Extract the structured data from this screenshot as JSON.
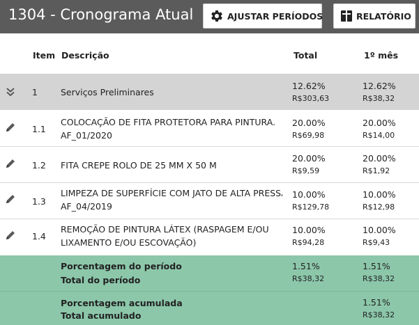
{
  "header": {
    "title": "1304 - Cronograma Atual",
    "ajustar_label": "AJUSTAR PERÍODOS",
    "relatorio_label": "RELATÓRIO"
  },
  "table": {
    "columns": {
      "item": "Item",
      "descricao": "Descrição",
      "total": "Total",
      "mes1": "1º mês"
    },
    "group": {
      "item": "1",
      "descricao": "Serviços Preliminares",
      "total_pct": "12.62%",
      "total_val": "R$303,63",
      "mes_pct": "12.62%",
      "mes_val": "R$38,32",
      "icon": "double-chevron-down-icon"
    },
    "rows": [
      {
        "item": "1.1",
        "desc_line1": "COLOCAÇÃO DE FITA PROTETORA PARA PINTURA.",
        "desc_line2": "AF_01/2020",
        "total_pct": "20.00%",
        "total_val": "R$69,98",
        "mes_pct": "20.00%",
        "mes_val": "R$14,00",
        "icon": "pencil-icon"
      },
      {
        "item": "1.2",
        "desc_line1": "FITA CREPE ROLO DE 25 MM X 50 M",
        "desc_line2": "",
        "total_pct": "20.00%",
        "total_val": "R$9,59",
        "mes_pct": "20.00%",
        "mes_val": "R$1,92",
        "icon": "pencil-icon"
      },
      {
        "item": "1.3",
        "desc_line1": "LIMPEZA DE SUPERFÍCIE COM JATO DE ALTA PRESSÃO.",
        "desc_line2": "AF_04/2019",
        "total_pct": "10.00%",
        "total_val": "R$129,78",
        "mes_pct": "10.00%",
        "mes_val": "R$12,98",
        "icon": "pencil-icon"
      },
      {
        "item": "1.4",
        "desc_line1": "REMOÇÃO DE PINTURA LÁTEX (RASPAGEM E/OU",
        "desc_line2": "LIXAMENTO E/OU ESCOVAÇÃO)",
        "total_pct": "10.00%",
        "total_val": "R$94,28",
        "mes_pct": "10.00%",
        "mes_val": "R$9,43",
        "icon": "pencil-icon"
      }
    ]
  },
  "summary": {
    "periodo": {
      "pct_label": "Porcentagem do período",
      "total_label": "Total do período",
      "total_pct": "1.51%",
      "total_val": "R$38,32",
      "mes_pct": "1.51%",
      "mes_val": "R$38,32"
    },
    "acumulado": {
      "pct_label": "Porcentagem acumulada",
      "total_label": "Total acumulado",
      "mes_pct": "1.51%",
      "mes_val": "R$38,32"
    }
  },
  "colors": {
    "topbar": "#5b5b5b",
    "group_row": "#d4d4d4",
    "summary": "#8cc7aa",
    "icon": "#5a5a5a"
  }
}
